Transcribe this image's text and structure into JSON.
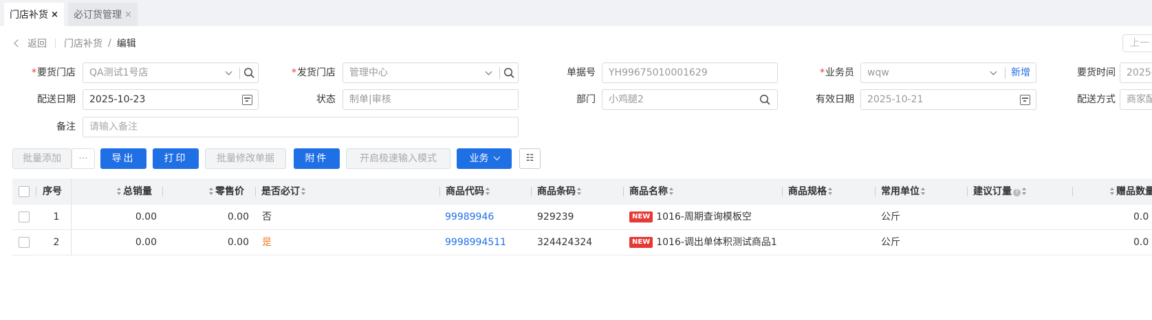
{
  "tabs": [
    {
      "label": "门店补货",
      "close": "×"
    },
    {
      "label": "必订货管理",
      "close": "×"
    }
  ],
  "breadcrumb": {
    "back": "返回",
    "parent": "门店补货",
    "sep": "/",
    "current": "编辑"
  },
  "nav": {
    "prev": "上一"
  },
  "form": {
    "req_mark": "*",
    "order_store": {
      "label": "要货门店",
      "value": "QA测试1号店"
    },
    "ship_store": {
      "label": "发货门店",
      "value": "管理中心"
    },
    "doc_no": {
      "label": "单据号",
      "value": "YH99675010001629"
    },
    "salesman": {
      "label": "业务员",
      "value": "wqw",
      "add": "新增"
    },
    "order_time": {
      "label": "要货时间",
      "value": "2025-"
    },
    "delivery_date": {
      "label": "配送日期",
      "value": "2025-10-23"
    },
    "status": {
      "label": "状态",
      "value": "制单|审核"
    },
    "dept": {
      "label": "部门",
      "value": "小鸡腿2"
    },
    "valid_date": {
      "label": "有效日期",
      "value": "2025-10-21"
    },
    "delivery_method": {
      "label": "配送方式",
      "value": "商家配"
    },
    "remark": {
      "label": "备注",
      "placeholder": "请输入备注"
    }
  },
  "toolbar": {
    "batch_add": "批量添加",
    "more": "···",
    "export": "导出",
    "print": "打印",
    "batch_edit": "批量修改单据",
    "attach": "附件",
    "fast_input": "开启极速输入模式",
    "business": "业务",
    "cols_icon": "☷"
  },
  "table": {
    "headers": {
      "seq": "序号",
      "total_sales": "总销量",
      "retail_price": "零售价",
      "must_order": "是否必订",
      "code": "商品代码",
      "barcode": "商品条码",
      "name": "商品名称",
      "spec": "商品规格",
      "unit": "常用单位",
      "suggest_qty": "建议订量",
      "gift_qty": "赠品数量"
    },
    "rows": [
      {
        "seq": "1",
        "total_sales": "0.00",
        "retail_price": "0.00",
        "must_order": "否",
        "code": "99989946",
        "barcode": "929239",
        "badge": "NEW",
        "name": "1016-周期查询模板空",
        "spec": "",
        "unit": "公斤",
        "suggest_qty": "",
        "gift_qty": "0.0"
      },
      {
        "seq": "2",
        "total_sales": "0.00",
        "retail_price": "0.00",
        "must_order": "是",
        "code": "9998994511",
        "barcode": "324424324",
        "badge": "NEW",
        "name": "1016-调出单体积测试商品1",
        "spec": "",
        "unit": "公斤",
        "suggest_qty": "",
        "gift_qty": "0.0"
      }
    ]
  },
  "colors": {
    "primary": "#1f6fe5",
    "required": "#e53935",
    "yes": "#f07d2a"
  }
}
